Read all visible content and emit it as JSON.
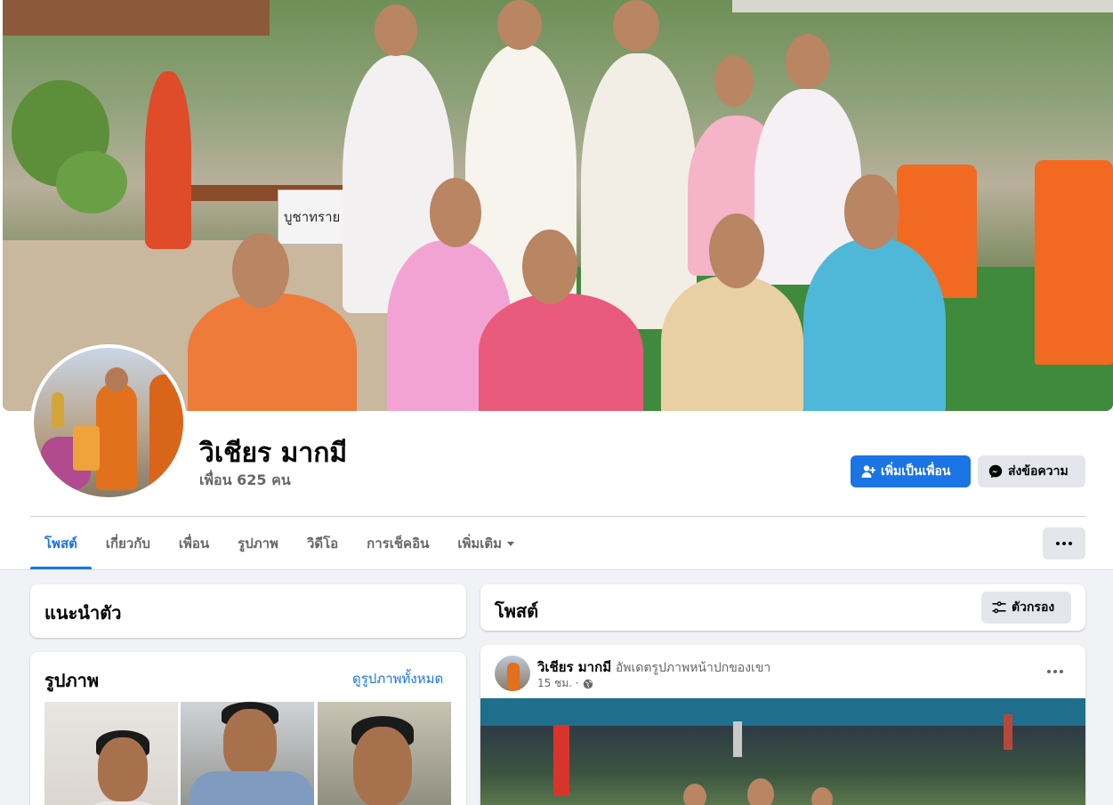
{
  "profile": {
    "name": "วิเชียร มากมี",
    "friends": "เพื่อน 625 คน"
  },
  "cover": {
    "sign_text": "บูชาทราย"
  },
  "actions": {
    "add_friend": "เพิ่มเป็นเพื่อน",
    "message": "ส่งข้อความ"
  },
  "tabs": [
    {
      "label": "โพสต์",
      "active": true
    },
    {
      "label": "เกี่ยวกับ"
    },
    {
      "label": "เพื่อน"
    },
    {
      "label": "รูปภาพ"
    },
    {
      "label": "วิดีโอ"
    },
    {
      "label": "การเช็คอิน"
    },
    {
      "label": "เพิ่มเติม"
    }
  ],
  "intro": {
    "title": "แนะนำตัว"
  },
  "photos": {
    "title": "รูปภาพ",
    "see_all": "ดูรูปภาพทั้งหมด"
  },
  "posts": {
    "title": "โพสต์",
    "filter": "ตัวกรอง"
  },
  "post": {
    "author": "วิเชียร มากมี",
    "action": "อัพเดตรูปภาพหน้าปกของเขา",
    "time": "15 ชม. ·",
    "audience_icon": "globe-icon"
  },
  "colors": {
    "accent": "#1b74e4",
    "page_bg": "#f0f2f5",
    "secondary_button": "#e4e6eb",
    "muted_text": "#65676b"
  }
}
